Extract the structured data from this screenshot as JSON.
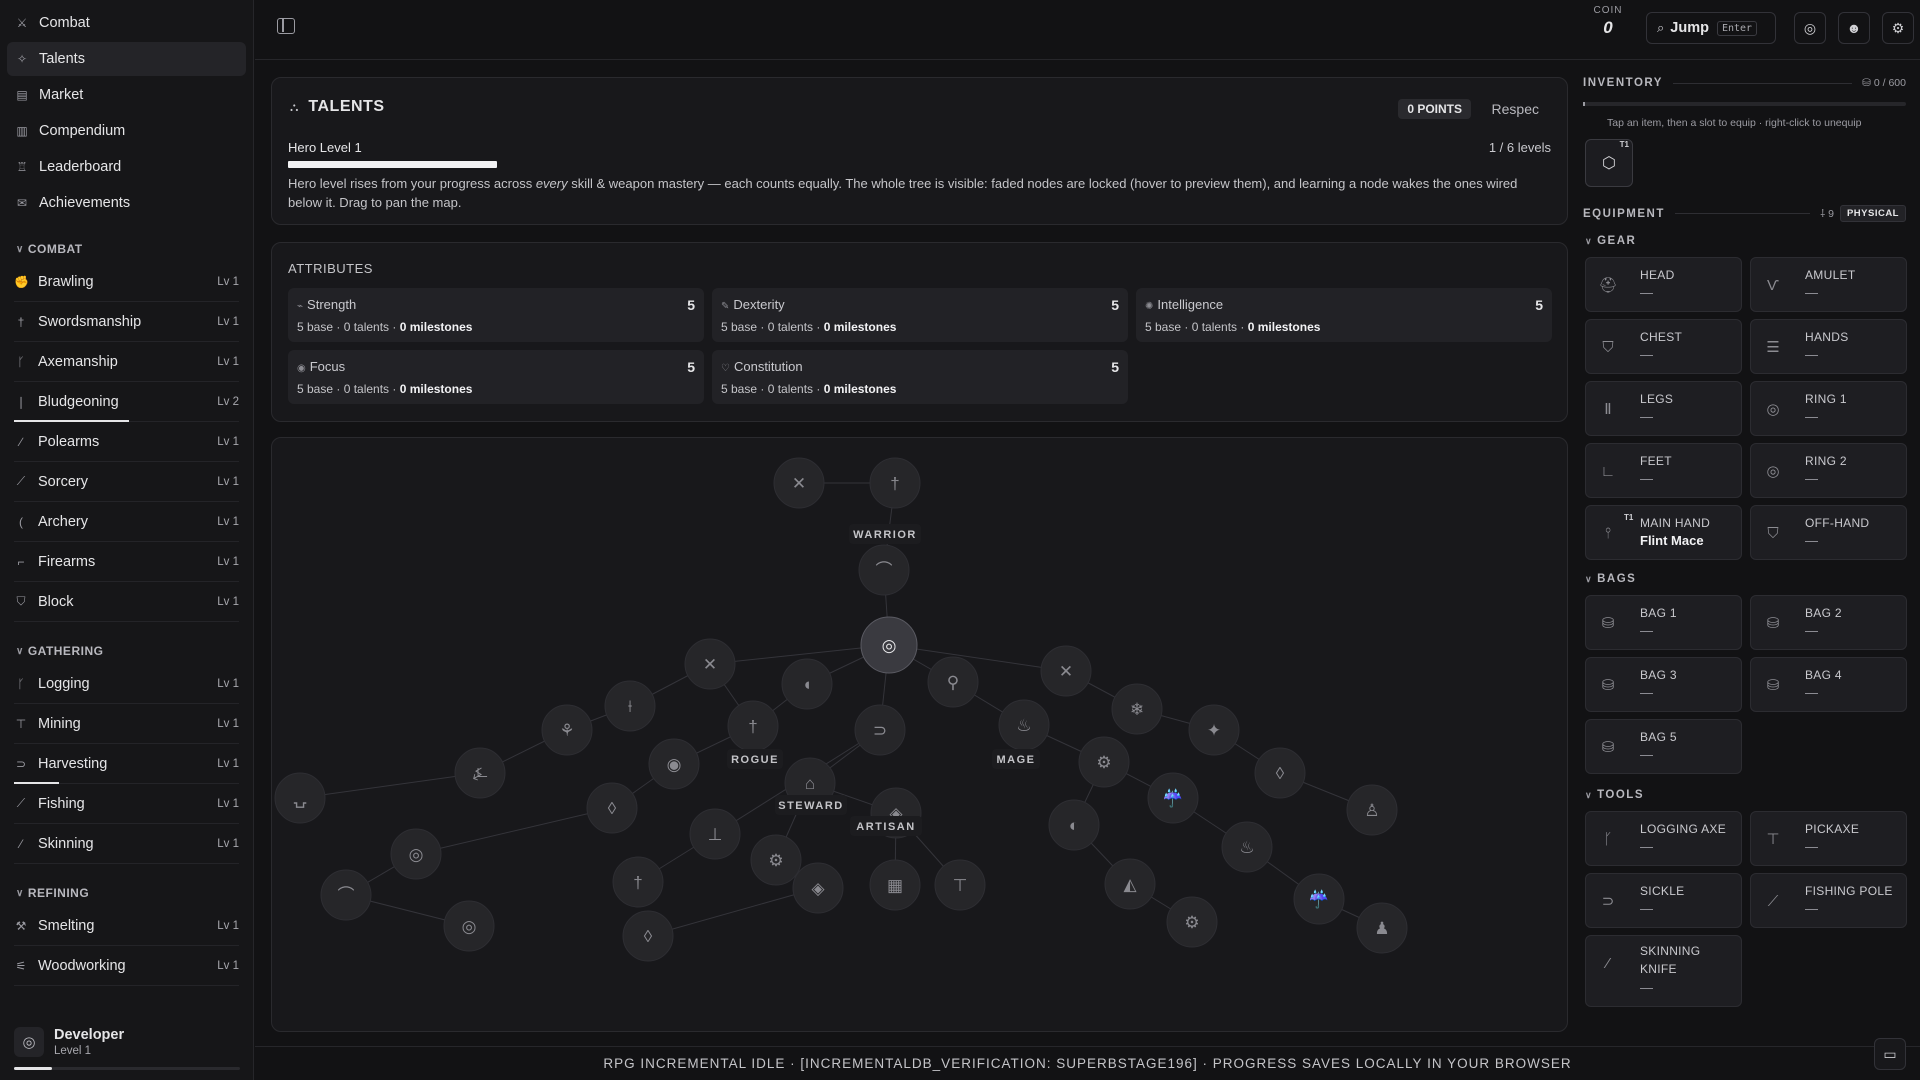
{
  "nav": {
    "items": [
      {
        "label": "Combat",
        "icon": "sword-icon",
        "glyph": "⚔",
        "active": false
      },
      {
        "label": "Talents",
        "icon": "star-icon",
        "glyph": "✧",
        "active": true
      },
      {
        "label": "Market",
        "icon": "market-icon",
        "glyph": "▤",
        "active": false
      },
      {
        "label": "Compendium",
        "icon": "book-icon",
        "glyph": "▥",
        "active": false
      },
      {
        "label": "Leaderboard",
        "icon": "trophy-icon",
        "glyph": "♖",
        "active": false
      },
      {
        "label": "Achievements",
        "icon": "medal-icon",
        "glyph": "✉",
        "active": false
      }
    ]
  },
  "groups": [
    {
      "title": "COMBAT",
      "skills": [
        {
          "name": "Brawling",
          "level": "Lv 1",
          "icon": "fists-icon",
          "glyph": "✊",
          "progress": 0
        },
        {
          "name": "Swordsmanship",
          "level": "Lv 1",
          "icon": "sword-icon",
          "glyph": "†",
          "progress": 0
        },
        {
          "name": "Axemanship",
          "level": "Lv 1",
          "icon": "axe-icon",
          "glyph": "ᚴ",
          "progress": 0
        },
        {
          "name": "Bludgeoning",
          "level": "Lv 2",
          "icon": "mace-icon",
          "glyph": "❘",
          "progress": 0.51
        },
        {
          "name": "Polearms",
          "level": "Lv 1",
          "icon": "polearm-icon",
          "glyph": "∕",
          "progress": 0
        },
        {
          "name": "Sorcery",
          "level": "Lv 1",
          "icon": "wand-icon",
          "glyph": "⟋",
          "progress": 0
        },
        {
          "name": "Archery",
          "level": "Lv 1",
          "icon": "bow-icon",
          "glyph": "(",
          "progress": 0
        },
        {
          "name": "Firearms",
          "level": "Lv 1",
          "icon": "gun-icon",
          "glyph": "⌐",
          "progress": 0
        },
        {
          "name": "Block",
          "level": "Lv 1",
          "icon": "shield-icon",
          "glyph": "⛉",
          "progress": 0
        }
      ]
    },
    {
      "title": "GATHERING",
      "skills": [
        {
          "name": "Logging",
          "level": "Lv 1",
          "icon": "axe-icon",
          "glyph": "ᚴ",
          "progress": 0
        },
        {
          "name": "Mining",
          "level": "Lv 1",
          "icon": "pickaxe-icon",
          "glyph": "⊤",
          "progress": 0
        },
        {
          "name": "Harvesting",
          "level": "Lv 1",
          "icon": "sickle-icon",
          "glyph": "⊃",
          "progress": 0.2
        },
        {
          "name": "Fishing",
          "level": "Lv 1",
          "icon": "fishing-pole-icon",
          "glyph": "⟋",
          "progress": 0
        },
        {
          "name": "Skinning",
          "level": "Lv 1",
          "icon": "knife-icon",
          "glyph": "⁄",
          "progress": 0
        }
      ]
    },
    {
      "title": "REFINING",
      "skills": [
        {
          "name": "Smelting",
          "level": "Lv 1",
          "icon": "hammer-icon",
          "glyph": "⚒",
          "progress": 0
        },
        {
          "name": "Woodworking",
          "level": "Lv 1",
          "icon": "saw-icon",
          "glyph": "⚟",
          "progress": 0
        }
      ]
    }
  ],
  "profile": {
    "name": "Developer",
    "level": "Level 1",
    "progress": 0.17
  },
  "topbar": {
    "coin_label": "COIN",
    "coin_value": "0",
    "jump_label": "Jump",
    "jump_key": "Enter",
    "buttons": [
      {
        "name": "steam-button",
        "icon": "steam-icon",
        "glyph": "◎"
      },
      {
        "name": "discord-button",
        "icon": "discord-icon",
        "glyph": "☻"
      },
      {
        "name": "settings-button",
        "icon": "gear-icon",
        "glyph": "⚙"
      }
    ]
  },
  "talents": {
    "title": "TALENTS",
    "points": "0 POINTS",
    "respec": "Respec",
    "hero_level": "Hero Level 1",
    "hero_levels": "1 / 6 levels",
    "hero_progress": 0.166,
    "desc_before": "Hero level rises from your progress across ",
    "desc_em": "every",
    "desc_after": " skill & weapon mastery — each counts equally. The whole tree is visible: faded nodes are locked (hover to preview them), and learning a node wakes the ones wired below it. Drag to pan the map."
  },
  "attributes": {
    "title": "ATTRIBUTES",
    "items": [
      {
        "name": "Strength",
        "value": "5",
        "base": "5 base · 0 talents · ",
        "milestones": "0 milestones",
        "icon": "arm-icon",
        "glyph": "💪"
      },
      {
        "name": "Dexterity",
        "value": "5",
        "base": "5 base · 0 talents · ",
        "milestones": "0 milestones",
        "icon": "feather-icon",
        "glyph": "✎"
      },
      {
        "name": "Intelligence",
        "value": "5",
        "base": "5 base · 0 talents · ",
        "milestones": "0 milestones",
        "icon": "brain-icon",
        "glyph": "✺"
      },
      {
        "name": "Focus",
        "value": "5",
        "base": "5 base · 0 talents · ",
        "milestones": "0 milestones",
        "icon": "eye-icon",
        "glyph": "◉"
      },
      {
        "name": "Constitution",
        "value": "5",
        "base": "5 base · 0 talents · ",
        "milestones": "0 milestones",
        "icon": "heart-icon",
        "glyph": "♡"
      }
    ]
  },
  "tree": {
    "labels": [
      "WARRIOR",
      "ROGUE",
      "MAGE",
      "STEWARD",
      "ARTISAN"
    ]
  },
  "inventory": {
    "title": "INVENTORY",
    "count": "0 / 600",
    "hint": "Tap an item, then a slot to equip · right-click to unequip",
    "slot_tier": "T1",
    "slot_icon": "box-icon",
    "used_fraction": 0
  },
  "equipment": {
    "title": "EQUIPMENT",
    "stat": "9",
    "damage_type": "PHYSICAL",
    "gear_title": "GEAR",
    "bags_title": "BAGS",
    "tools_title": "TOOLS",
    "gear": [
      {
        "label": "HEAD",
        "value": "—",
        "icon": "helmet-icon",
        "glyph": "⛑"
      },
      {
        "label": "AMULET",
        "value": "—",
        "icon": "amulet-icon",
        "glyph": "Ѵ"
      },
      {
        "label": "CHEST",
        "value": "—",
        "icon": "chestplate-icon",
        "glyph": "⛉"
      },
      {
        "label": "HANDS",
        "value": "—",
        "icon": "gloves-icon",
        "glyph": "☰"
      },
      {
        "label": "LEGS",
        "value": "—",
        "icon": "legs-icon",
        "glyph": "Ⅱ"
      },
      {
        "label": "RING 1",
        "value": "—",
        "icon": "ring-icon",
        "glyph": "◎"
      },
      {
        "label": "FEET",
        "value": "—",
        "icon": "boot-icon",
        "glyph": "∟"
      },
      {
        "label": "RING 2",
        "value": "—",
        "icon": "ring-icon",
        "glyph": "◎"
      },
      {
        "label": "MAIN HAND",
        "value": "Flint Mace",
        "icon": "mace-icon",
        "glyph": "⫯",
        "tier": "T1"
      },
      {
        "label": "OFF-HAND",
        "value": "—",
        "icon": "shield-icon",
        "glyph": "⛉"
      }
    ],
    "bags": [
      {
        "label": "BAG 1",
        "value": "—",
        "icon": "bag-icon",
        "glyph": "⛁"
      },
      {
        "label": "BAG 2",
        "value": "—",
        "icon": "bag-icon",
        "glyph": "⛁"
      },
      {
        "label": "BAG 3",
        "value": "—",
        "icon": "bag-icon",
        "glyph": "⛁"
      },
      {
        "label": "BAG 4",
        "value": "—",
        "icon": "bag-icon",
        "glyph": "⛁"
      },
      {
        "label": "BAG 5",
        "value": "—",
        "icon": "bag-icon",
        "glyph": "⛁"
      }
    ],
    "tools": [
      {
        "label": "LOGGING AXE",
        "value": "—",
        "icon": "axe-icon",
        "glyph": "ᚴ"
      },
      {
        "label": "PICKAXE",
        "value": "—",
        "icon": "pickaxe-icon",
        "glyph": "⊤"
      },
      {
        "label": "SICKLE",
        "value": "—",
        "icon": "sickle-icon",
        "glyph": "⊃"
      },
      {
        "label": "FISHING POLE",
        "value": "—",
        "icon": "fishing-pole-icon",
        "glyph": "⟋"
      },
      {
        "label": "SKINNING KNIFE",
        "value": "—",
        "icon": "knife-icon",
        "glyph": "⁄"
      }
    ]
  },
  "footer": {
    "text": "RPG INCREMENTAL IDLE · [INCREMENTALDB_VERIFICATION: SUPERBSTAGE196] · PROGRESS SAVES LOCALLY IN YOUR BROWSER"
  }
}
